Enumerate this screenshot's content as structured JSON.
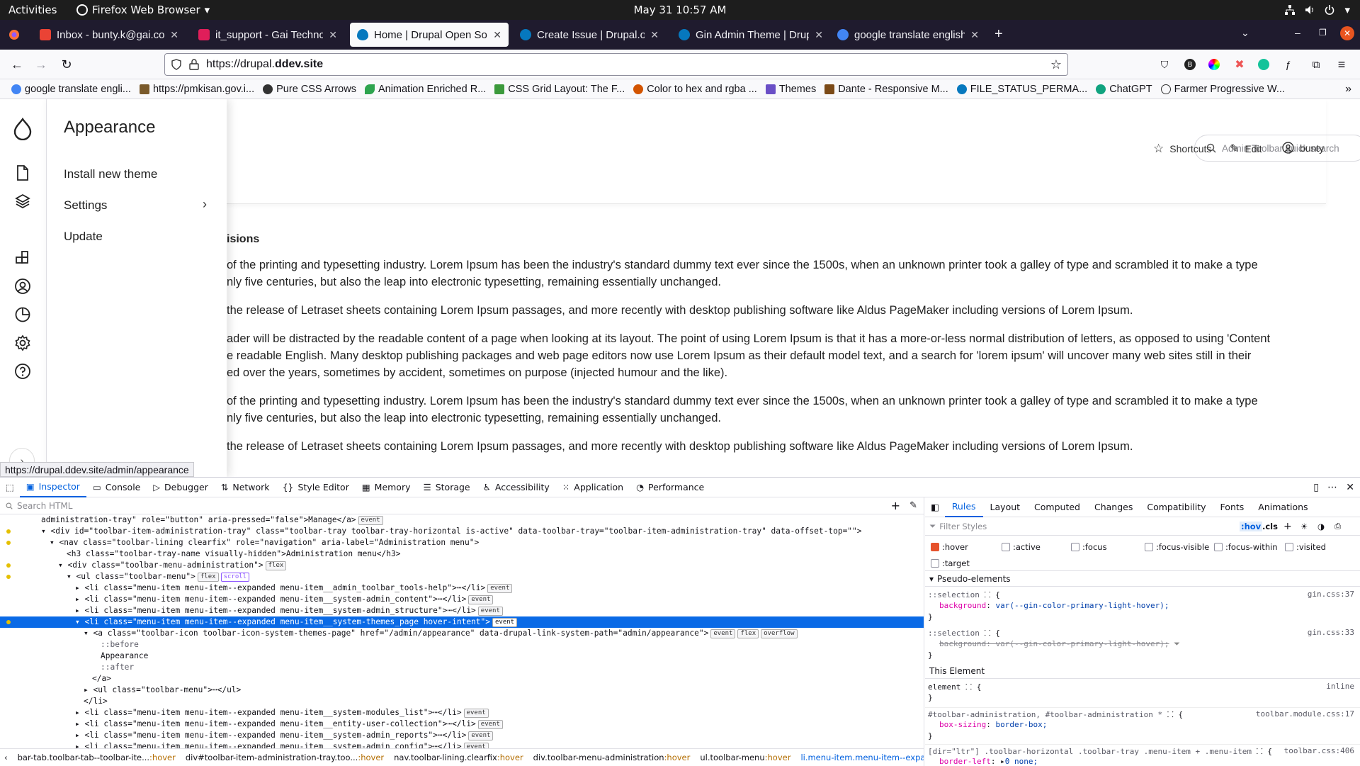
{
  "gnome": {
    "activities": "Activities",
    "app_name": "Firefox Web Browser",
    "clock": "May 31  10:57 AM"
  },
  "tabs": [
    {
      "title": "Inbox - bunty.k@gai.co.in",
      "color": "#ea4335"
    },
    {
      "title": "it_support - Gai Technolo",
      "color": "#e01e5a"
    },
    {
      "title": "Home | Drupal Open Sou",
      "color": "#0678be"
    },
    {
      "title": "Create Issue | Drupal.org",
      "color": "#0678be"
    },
    {
      "title": "Gin Admin Theme | Drupa",
      "color": "#0678be"
    },
    {
      "title": "google translate english",
      "color": "#4285f4"
    }
  ],
  "url": {
    "scheme": "https://drupal.",
    "host": "ddev.site"
  },
  "bookmarks": [
    "google translate engli...",
    "https://pmkisan.gov.i...",
    "Pure CSS Arrows",
    "Animation Enriched R...",
    "CSS Grid Layout: The F...",
    "Color to hex and rgba ...",
    "Themes",
    "Dante - Responsive M...",
    "FILE_STATUS_PERMA...",
    "ChatGPT",
    "Farmer Progressive W..."
  ],
  "flyout": {
    "title": "Appearance",
    "items": [
      "Install new theme",
      "Settings",
      "Update"
    ]
  },
  "header": {
    "search_placeholder": "Admin Toolbar quick search",
    "shortcuts": "Shortcuts",
    "edit": "Edit",
    "user": "bunty"
  },
  "content": {
    "heading": "isions",
    "paragraphs": [
      "of the printing and typesetting industry. Lorem Ipsum has been the industry's standard dummy text ever since the 1500s, when an unknown printer took a galley of type and scrambled it to make a type",
      "nly five centuries, but also the leap into electronic typesetting, remaining essentially unchanged.",
      "the release of Letraset sheets containing Lorem Ipsum passages, and more recently with desktop publishing software like Aldus PageMaker including versions of Lorem Ipsum.",
      "ader will be distracted by the readable content of a page when looking at its layout. The point of using Lorem Ipsum is that it has a more-or-less normal distribution of letters, as opposed to using 'Content",
      "e readable English. Many desktop publishing packages and web page editors now use Lorem Ipsum as their default model text, and a search for 'lorem ipsum' will uncover many web sites still in their",
      "ed over the years, sometimes by accident, sometimes on purpose (injected humour and the like).",
      "of the printing and typesetting industry. Lorem Ipsum has been the industry's standard dummy text ever since the 1500s, when an unknown printer took a galley of type and scrambled it to make a type",
      "nly five centuries, but also the leap into electronic typesetting, remaining essentially unchanged.",
      "the release of Letraset sheets containing Lorem Ipsum passages, and more recently with desktop publishing software like Aldus PageMaker including versions of Lorem Ipsum."
    ]
  },
  "status_url": "https://drupal.ddev.site/admin/appearance",
  "devtools": {
    "tabs": [
      "Inspector",
      "Console",
      "Debugger",
      "Network",
      "Style Editor",
      "Memory",
      "Storage",
      "Accessibility",
      "Application",
      "Performance"
    ],
    "search_placeholder": "Search HTML",
    "markup": [
      {
        "t": "administration-tray\" role=\"button\" aria-pressed=\"false\">Manage</a>",
        "b": [
          "event"
        ],
        "indent": 0
      },
      {
        "t": "<div id=\"toolbar-item-administration-tray\" class=\"toolbar-tray toolbar-tray-horizontal is-active\" data-toolbar-tray=\"toolbar-item-administration-tray\" data-offset-top=\"\">",
        "b": [],
        "indent": 1,
        "arrow": "▾",
        "dot": true
      },
      {
        "t": "<nav class=\"toolbar-lining clearfix\" role=\"navigation\" aria-label=\"Administration menu\">",
        "b": [],
        "indent": 2,
        "arrow": "▾",
        "dot": true
      },
      {
        "t": "<h3 class=\"toolbar-tray-name visually-hidden\">Administration menu</h3>",
        "b": [],
        "indent": 3
      },
      {
        "t": "<div class=\"toolbar-menu-administration\">",
        "b": [
          "flex"
        ],
        "indent": 3,
        "arrow": "▾",
        "dot": true
      },
      {
        "t": "<ul class=\"toolbar-menu\">",
        "b": [
          "flex",
          "scroll"
        ],
        "indent": 4,
        "arrow": "▾",
        "dot": true
      },
      {
        "t": "<li class=\"menu-item menu-item--expanded menu-item__admin_toolbar_tools-help\">⋯</li>",
        "b": [
          "event"
        ],
        "indent": 5,
        "arrow": "▸"
      },
      {
        "t": "<li class=\"menu-item menu-item--expanded menu-item__system-admin_content\">⋯</li>",
        "b": [
          "event"
        ],
        "indent": 5,
        "arrow": "▸"
      },
      {
        "t": "<li class=\"menu-item menu-item--expanded menu-item__system-admin_structure\">⋯</li>",
        "b": [
          "event"
        ],
        "indent": 5,
        "arrow": "▸"
      },
      {
        "t": "<li class=\"menu-item menu-item--expanded menu-item__system-themes_page hover-intent\">",
        "b": [
          "event"
        ],
        "indent": 5,
        "arrow": "▾",
        "sel": true,
        "dot": true
      },
      {
        "t": "<a class=\"toolbar-icon toolbar-icon-system-themes-page\" href=\"/admin/appearance\" data-drupal-link-system-path=\"admin/appearance\">",
        "b": [
          "event",
          "flex",
          "overflow"
        ],
        "indent": 6,
        "arrow": "▾"
      },
      {
        "t": "::before",
        "b": [],
        "indent": 7,
        "pe": true
      },
      {
        "t": "Appearance",
        "b": [],
        "indent": 7
      },
      {
        "t": "::after",
        "b": [],
        "indent": 7,
        "pe": true
      },
      {
        "t": "</a>",
        "b": [],
        "indent": 6
      },
      {
        "t": "<ul class=\"toolbar-menu\">⋯</ul>",
        "b": [],
        "indent": 6,
        "arrow": "▸"
      },
      {
        "t": "</li>",
        "b": [],
        "indent": 5
      },
      {
        "t": "<li class=\"menu-item menu-item--expanded menu-item__system-modules_list\">⋯</li>",
        "b": [
          "event"
        ],
        "indent": 5,
        "arrow": "▸"
      },
      {
        "t": "<li class=\"menu-item menu-item--expanded menu-item__entity-user-collection\">⋯</li>",
        "b": [
          "event"
        ],
        "indent": 5,
        "arrow": "▸"
      },
      {
        "t": "<li class=\"menu-item menu-item--expanded menu-item__system-admin_reports\">⋯</li>",
        "b": [
          "event"
        ],
        "indent": 5,
        "arrow": "▸"
      },
      {
        "t": "<li class=\"menu-item menu-item--expanded menu-item__system-admin_config\">⋯</li>",
        "b": [
          "event"
        ],
        "indent": 5,
        "arrow": "▸"
      }
    ],
    "breadcrumbs": [
      {
        "n": "bar-tab.toolbar-tab--toolbar-ite...",
        "h": ":hover"
      },
      {
        "n": "div#toolbar-item-administration-tray.too...",
        "h": ":hover"
      },
      {
        "n": "nav.toolbar-lining.clearfix",
        "h": ":hover"
      },
      {
        "n": "div.toolbar-menu-administration",
        "h": ":hover"
      },
      {
        "n": "ul.toolbar-menu",
        "h": ":hover"
      },
      {
        "n": "li.menu-item.menu-item--expanded.menu-it...",
        "h": ":hover"
      }
    ],
    "side_tabs": [
      "Rules",
      "Layout",
      "Computed",
      "Changes",
      "Compatibility",
      "Fonts",
      "Animations"
    ],
    "filter_placeholder": "Filter Styles",
    "hov": ":hov",
    "cls": ".cls",
    "pseudo_classes": [
      ":hover",
      ":active",
      ":focus",
      ":focus-visible",
      ":focus-within",
      ":visited",
      ":target"
    ],
    "pseudo_elements_title": "Pseudo-elements",
    "this_element_title": "This Element",
    "rules": {
      "sel1": "::selection",
      "src1": "gin.css:37",
      "prop1": "background",
      "val1": "var(--gin-color-primary-light-hover);",
      "sel2": "::selection",
      "src2": "gin.css:33",
      "prop2": "background",
      "val2": "var(--gin-color-primary-light-hover);",
      "element": "element",
      "element_src": "inline",
      "sel3": "#toolbar-administration, #toolbar-administration *",
      "src3": "toolbar.module.css:17",
      "prop3": "box-sizing",
      "val3": "border-box;",
      "sel4": "[dir=\"ltr\"] .toolbar-horizontal .toolbar-tray .menu-item + .menu-item",
      "src4": "toolbar.css:406",
      "prop4": "border-left",
      "val4": "0 none;"
    }
  }
}
